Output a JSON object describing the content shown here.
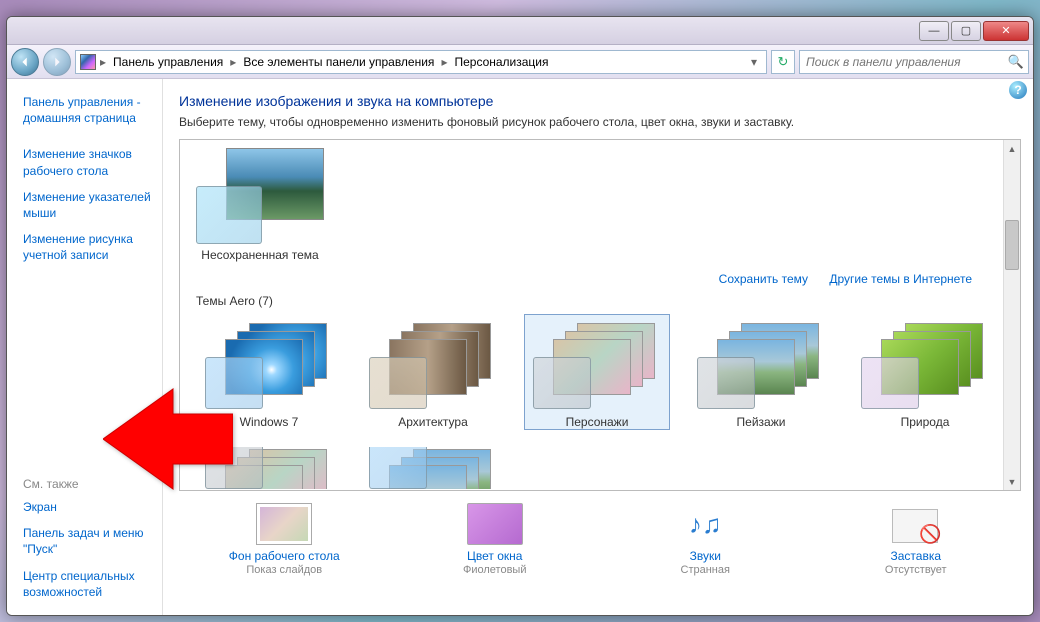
{
  "breadcrumb": {
    "items": [
      "Панель управления",
      "Все элементы панели управления",
      "Персонализация"
    ]
  },
  "search": {
    "placeholder": "Поиск в панели управления"
  },
  "sidebar": {
    "links": [
      "Панель управления - домашняя страница",
      "Изменение значков рабочего стола",
      "Изменение указателей мыши",
      "Изменение рисунка учетной записи"
    ],
    "see_also_header": "См. также",
    "see_also": [
      "Экран",
      "Панель задач и меню \"Пуск\"",
      "Центр специальных возможностей"
    ]
  },
  "main": {
    "heading": "Изменение изображения и звука на компьютере",
    "subtitle": "Выберите тему, чтобы одновременно изменить фоновый рисунок рабочего стола, цвет окна, звуки и заставку.",
    "unsaved_label": "Несохраненная тема",
    "save_theme": "Сохранить тему",
    "more_online": "Другие темы в Интернете",
    "aero_section": "Темы Aero (7)",
    "themes": [
      {
        "label": "Windows 7",
        "wall": "win7-wall",
        "glass": "g-blue",
        "selected": false
      },
      {
        "label": "Архитектура",
        "wall": "arch-wall",
        "glass": "g-tan",
        "selected": false
      },
      {
        "label": "Персонажи",
        "wall": "char-wall",
        "glass": "g-gray",
        "selected": true
      },
      {
        "label": "Пейзажи",
        "wall": "land-wall",
        "glass": "g-gray",
        "selected": false
      },
      {
        "label": "Природа",
        "wall": "nat-wall",
        "glass": "g-lav",
        "selected": false
      }
    ]
  },
  "bottom": [
    {
      "label": "Фон рабочего стола",
      "sub": "Показ слайдов",
      "icon": "bg"
    },
    {
      "label": "Цвет окна",
      "sub": "Фиолетовый",
      "icon": "color"
    },
    {
      "label": "Звуки",
      "sub": "Странная",
      "icon": "sound"
    },
    {
      "label": "Заставка",
      "sub": "Отсутствует",
      "icon": "saver"
    }
  ]
}
